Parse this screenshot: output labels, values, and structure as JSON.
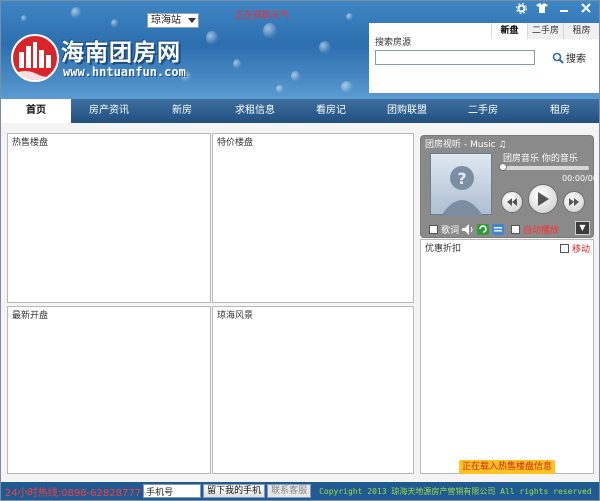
{
  "header": {
    "logo_title": "海南团房网",
    "logo_url": "www.hntuanfun.com",
    "city": "琼海站",
    "weather_status": "正在获取天气",
    "window_controls": [
      "gear-icon",
      "shirt-icon",
      "minimize-icon",
      "close-icon"
    ]
  },
  "search": {
    "tabs": [
      "新盘",
      "二手房",
      "租房"
    ],
    "active_tab": "新盘",
    "label": "搜索房源",
    "input_value": "",
    "button_label": "搜索"
  },
  "nav": {
    "items": [
      "首页",
      "房产资讯",
      "新房",
      "求租信息",
      "看房记",
      "团购联盟",
      "二手房",
      "租房"
    ],
    "active": "首页"
  },
  "panels": {
    "hot_listings": "热售楼盘",
    "special_listings": "特价楼盘",
    "new_openings": "最新开盘",
    "qionghai_scenery": "琼海风景",
    "promotions": "优惠折扣",
    "move_label": "移动"
  },
  "player": {
    "title": "团房视听 - Music ♫",
    "track": "团房音乐 你的音乐",
    "time": "00:00/00:00",
    "lyrics_label": "歌词",
    "autoplay_label": "自动播放"
  },
  "footer": {
    "hotline": "24小时热线:0898-62828777",
    "phone_placeholder": "手机号",
    "leave_phone_button": "留下我的手机",
    "contact_button": "联系客服",
    "copyright": "Copyright 2013 琼海天地源房产营销有限公司 All rights reserved"
  },
  "status": {
    "loading_text": "正在载入热售楼盘信息"
  },
  "colors": {
    "nav_bg": "#21507f",
    "header_blue": "#2c6eae",
    "hotline_red": "#ff3b3b",
    "copyright_green": "#9fdc3f",
    "loading_bg": "#ffc21f"
  }
}
